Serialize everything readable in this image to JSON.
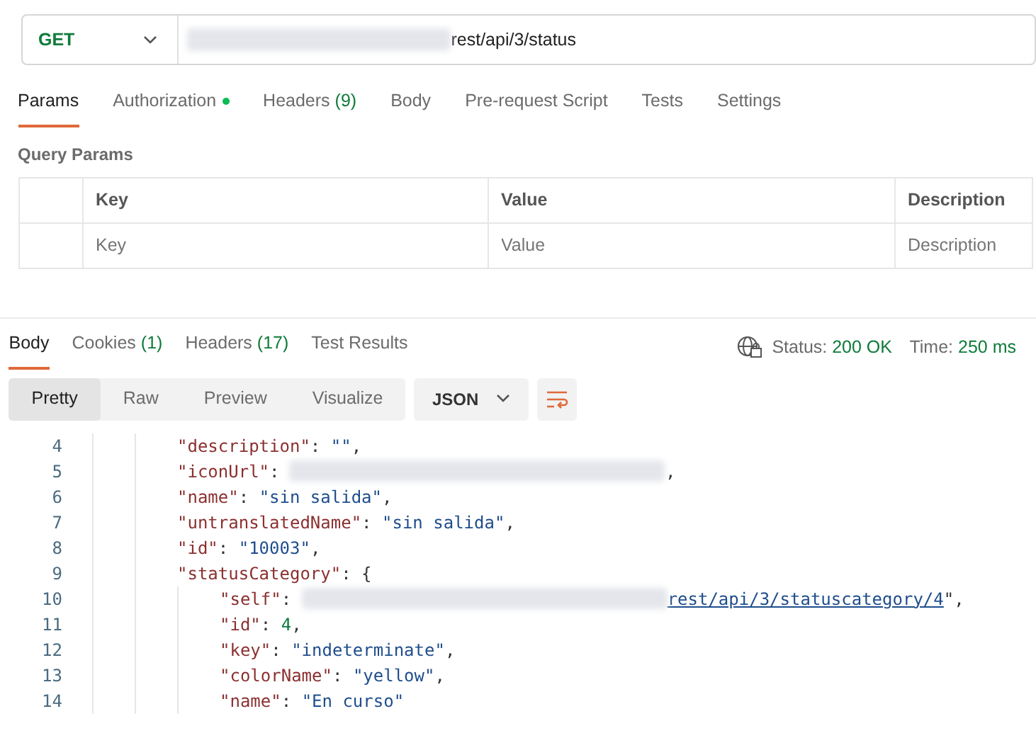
{
  "request": {
    "method": "GET",
    "url_tail": "rest/api/3/status"
  },
  "request_tabs": [
    {
      "label": "Params",
      "selected": true
    },
    {
      "label": "Authorization",
      "selected": false,
      "dot": true
    },
    {
      "label": "Headers",
      "count": "(9)",
      "selected": false
    },
    {
      "label": "Body",
      "selected": false
    },
    {
      "label": "Pre-request Script",
      "selected": false
    },
    {
      "label": "Tests",
      "selected": false
    },
    {
      "label": "Settings",
      "selected": false
    }
  ],
  "query_params": {
    "title": "Query Params",
    "columns": [
      "Key",
      "Value",
      "Description"
    ],
    "placeholders": [
      "Key",
      "Value",
      "Description"
    ]
  },
  "response_tabs": [
    {
      "label": "Body",
      "selected": true
    },
    {
      "label": "Cookies",
      "count": "(1)",
      "selected": false
    },
    {
      "label": "Headers",
      "count": "(17)",
      "selected": false
    },
    {
      "label": "Test Results",
      "selected": false
    }
  ],
  "response_status": {
    "status_label": "Status:",
    "status": "200 OK",
    "time_label": "Time:",
    "time": "250 ms"
  },
  "view_modes": [
    {
      "label": "Pretty",
      "selected": true
    },
    {
      "label": "Raw",
      "selected": false
    },
    {
      "label": "Preview",
      "selected": false
    },
    {
      "label": "Visualize",
      "selected": false
    }
  ],
  "format": "JSON",
  "code_lines": [
    {
      "number": "4",
      "tokens": [
        {
          "kind": "key",
          "text": "\"description\""
        },
        {
          "kind": "punct",
          "text": ": "
        },
        {
          "kind": "string",
          "text": "\"\""
        },
        {
          "kind": "punct",
          "text": ","
        }
      ]
    },
    {
      "number": "5",
      "tokens": [
        {
          "kind": "key",
          "text": "\"iconUrl\""
        },
        {
          "kind": "punct",
          "text": ": "
        },
        {
          "kind": "redacted"
        },
        {
          "kind": "punct",
          "text": ","
        }
      ]
    },
    {
      "number": "6",
      "tokens": [
        {
          "kind": "key",
          "text": "\"name\""
        },
        {
          "kind": "punct",
          "text": ": "
        },
        {
          "kind": "string",
          "text": "\"sin salida\""
        },
        {
          "kind": "punct",
          "text": ","
        }
      ]
    },
    {
      "number": "7",
      "tokens": [
        {
          "kind": "key",
          "text": "\"untranslatedName\""
        },
        {
          "kind": "punct",
          "text": ": "
        },
        {
          "kind": "string",
          "text": "\"sin salida\""
        },
        {
          "kind": "punct",
          "text": ","
        }
      ]
    },
    {
      "number": "8",
      "tokens": [
        {
          "kind": "key",
          "text": "\"id\""
        },
        {
          "kind": "punct",
          "text": ": "
        },
        {
          "kind": "string",
          "text": "\"10003\""
        },
        {
          "kind": "punct",
          "text": ","
        }
      ]
    },
    {
      "number": "9",
      "tokens": [
        {
          "kind": "key",
          "text": "\"statusCategory\""
        },
        {
          "kind": "punct",
          "text": ": {"
        }
      ],
      "children": [
        {
          "number": "10",
          "tokens": [
            {
              "kind": "key",
              "text": "\"self\""
            },
            {
              "kind": "punct",
              "text": ": "
            },
            {
              "kind": "redacted"
            },
            {
              "kind": "link",
              "text": "rest/api/3/statuscategory/4"
            },
            {
              "kind": "punct",
              "text": "\","
            }
          ]
        },
        {
          "number": "11",
          "tokens": [
            {
              "kind": "key",
              "text": "\"id\""
            },
            {
              "kind": "punct",
              "text": ": "
            },
            {
              "kind": "number",
              "text": "4"
            },
            {
              "kind": "punct",
              "text": ","
            }
          ]
        },
        {
          "number": "12",
          "tokens": [
            {
              "kind": "key",
              "text": "\"key\""
            },
            {
              "kind": "punct",
              "text": ": "
            },
            {
              "kind": "string",
              "text": "\"indeterminate\""
            },
            {
              "kind": "punct",
              "text": ","
            }
          ]
        },
        {
          "number": "13",
          "tokens": [
            {
              "kind": "key",
              "text": "\"colorName\""
            },
            {
              "kind": "punct",
              "text": ": "
            },
            {
              "kind": "string",
              "text": "\"yellow\""
            },
            {
              "kind": "punct",
              "text": ","
            }
          ]
        },
        {
          "number": "14",
          "tokens": [
            {
              "kind": "key",
              "text": "\"name\""
            },
            {
              "kind": "punct",
              "text": ": "
            },
            {
              "kind": "string",
              "text": "\"En curso\""
            }
          ]
        }
      ]
    }
  ]
}
